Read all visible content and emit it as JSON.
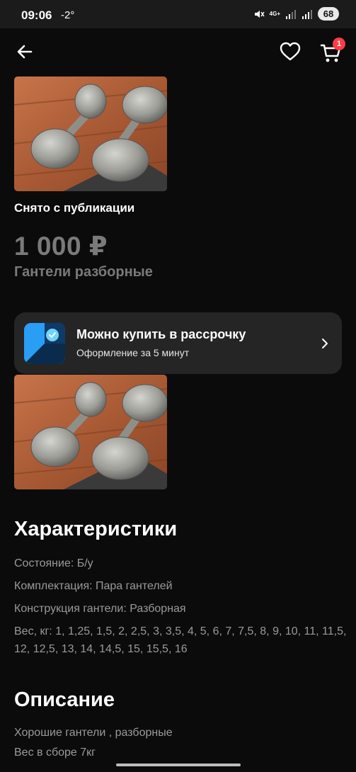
{
  "status_bar": {
    "time": "09:06",
    "temperature": "-2°",
    "network": "4G+",
    "battery": "68"
  },
  "header": {
    "back_icon": "arrow-left-icon",
    "favorite_icon": "heart-outline-icon",
    "cart_icon": "cart-icon",
    "cart_count": "1"
  },
  "listing": {
    "status": "Снято с публикации",
    "price": "1 000 ₽",
    "title": "Гантели разборные"
  },
  "installment": {
    "title": "Можно купить в рассрочку",
    "subtitle": "Оформление за 5 минут"
  },
  "characteristics": {
    "heading": "Характеристики",
    "items": [
      "Состояние: Б/у",
      "Комплектация: Пара гантелей",
      "Конструкция гантели: Разборная",
      "Вес, кг: 1, 1,25, 1,5, 2, 2,5, 3, 3,5, 4, 5, 6, 7, 7,5, 8, 9, 10, 11, 11,5, 12, 12,5, 13, 14, 14,5, 15, 15,5, 16"
    ]
  },
  "description": {
    "heading": "Описание",
    "lines": [
      "Хорошие гантели , разборные",
      "Вес в сборе 7кг"
    ]
  },
  "colors": {
    "background": "#0b0b0b",
    "card": "#252525",
    "muted_text": "#7a7a7a",
    "badge": "#ff3b47"
  }
}
